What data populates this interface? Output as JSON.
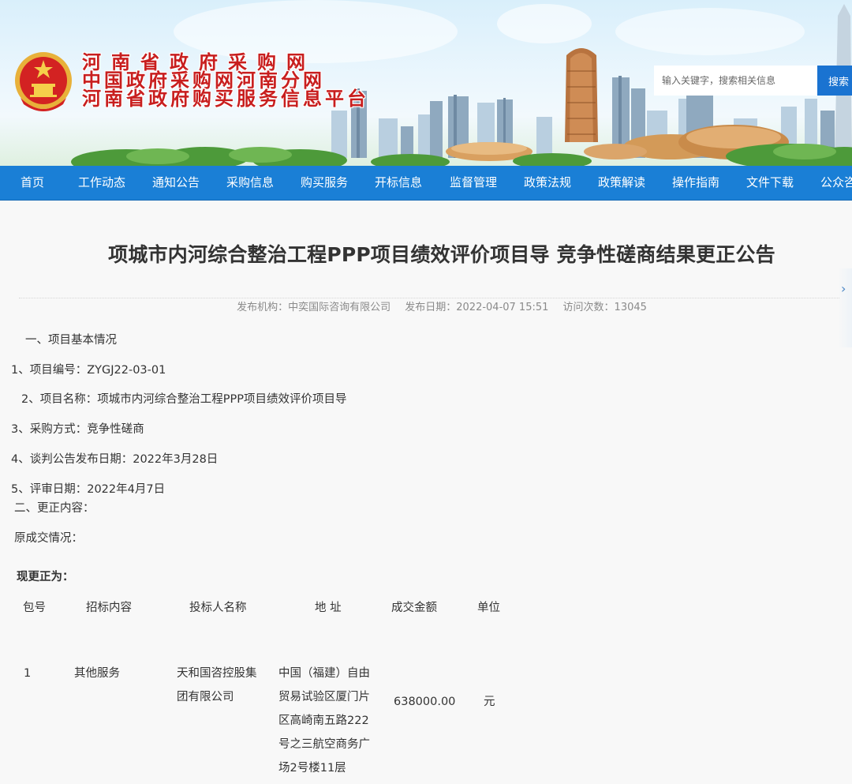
{
  "header": {
    "site_titles": [
      "河南省政府采购网",
      "中国政府采购网河南分网",
      "河南省政府购买服务信息平台"
    ],
    "search": {
      "placeholder": "输入关键字，搜索相关信息",
      "button_label": "搜索"
    }
  },
  "nav": {
    "items": [
      "首页",
      "工作动态",
      "通知公告",
      "采购信息",
      "购买服务",
      "开标信息",
      "监督管理",
      "政策法规",
      "政策解读",
      "操作指南",
      "文件下载",
      "公众咨"
    ]
  },
  "article": {
    "title": "项城市内河综合整治工程PPP项目绩效评价项目导 竞争性磋商结果更正公告",
    "meta": {
      "publisher": "发布机构：中奕国际咨询有限公司",
      "publish_date": "发布日期：2022-04-07 15:51",
      "views": "访问次数：13045"
    },
    "sections": {
      "basic_heading": "一、项目基本情况",
      "project_number": "1、项目编号：ZYGJ22-03-01",
      "project_name": "2、项目名称：项城市内河综合整治工程PPP项目绩效评价项目导",
      "procurement_method": "3、采购方式：竞争性磋商",
      "announcement_date": "4、谈判公告发布日期：2022年3月28日",
      "review_date": "5、评审日期：2022年4月7日",
      "correction_heading": "二、更正内容：",
      "original_label": "原成交情况：",
      "corrected_label": "现更正为："
    },
    "table": {
      "headers": [
        "包号",
        "招标内容",
        "投标人名称",
        "地 址",
        "成交金额",
        "单位"
      ],
      "row": {
        "package_no": "1",
        "content": "其他服务",
        "bidder_lines": [
          "天和国咨控股集",
          "团有限公司"
        ],
        "address_lines": [
          "中国（福建）自由",
          "贸易试验区厦门片",
          "区高崎南五路222",
          "号之三航空商务广",
          "场2号楼11层"
        ],
        "amount": "638000.00",
        "unit": "元"
      }
    }
  },
  "colors": {
    "nav_bg": "#1a7fd6",
    "title_red": "#c81e1e",
    "search_button": "#1a73d1"
  }
}
